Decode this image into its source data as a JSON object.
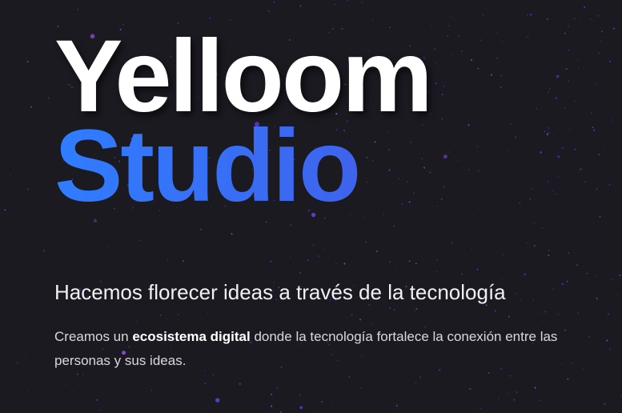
{
  "hero": {
    "title_line1": "Yelloom",
    "title_line2": "Studio",
    "tagline": "Hacemos florecer ideas a través de la tecnología",
    "description": {
      "before": "Creamos un ",
      "highlight": "ecosistema digital",
      "after": " donde la tecnología fortalece la conexión entre las personas y sus ideas."
    }
  },
  "colors": {
    "background": "#1c1a21",
    "title_primary": "#ffffff",
    "gradient_start": "#2f7dff",
    "gradient_end": "#4a45e0",
    "star_colors": [
      "#6a3fd6",
      "#3b3fd8",
      "#8a4fe0",
      "#4a55ff"
    ]
  }
}
